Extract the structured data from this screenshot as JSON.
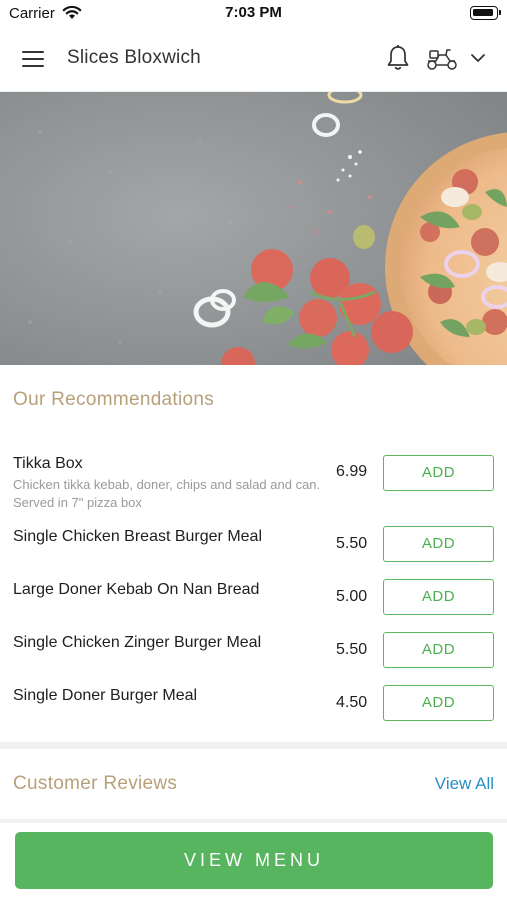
{
  "status_bar": {
    "carrier": "Carrier",
    "time": "7:03 PM"
  },
  "header": {
    "title": "Slices Bloxwich",
    "icons": [
      "menu-icon",
      "bell-icon",
      "scooter-icon",
      "chevron-down-icon"
    ]
  },
  "recommendations": {
    "title": "Our Recommendations",
    "items": [
      {
        "name": "Tikka Box",
        "description": "Chicken tikka kebab, doner, chips and salad and can. Served in 7\" pizza box",
        "price": "6.99",
        "button": "ADD"
      },
      {
        "name": "Single Chicken Breast Burger Meal",
        "price": "5.50",
        "button": "ADD"
      },
      {
        "name": "Large Doner Kebab On Nan Bread",
        "price": "5.00",
        "button": "ADD"
      },
      {
        "name": "Single Chicken Zinger Burger Meal",
        "price": "5.50",
        "button": "ADD"
      },
      {
        "name": "Single Doner Burger Meal",
        "price": "4.50",
        "button": "ADD"
      }
    ]
  },
  "reviews": {
    "title": "Customer Reviews",
    "link": "View All"
  },
  "footer": {
    "button": "VIEW MENU"
  },
  "colors": {
    "accent_green": "#58b55f",
    "section_title_tan": "#b7a17a",
    "link_blue": "#2a8fc7"
  }
}
